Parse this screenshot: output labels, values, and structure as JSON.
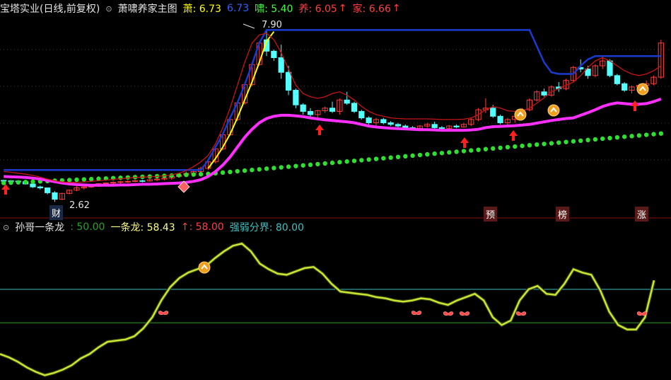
{
  "header": {
    "stock_name": "宝塔实业(日线,前复权)",
    "indicator_name": "萧啸养家主图",
    "items": [
      {
        "label": "萧: 6.73",
        "color": "#ffff00"
      },
      {
        "label": "6.73",
        "color": "#3060ff"
      },
      {
        "label": "啸: 5.40",
        "color": "#40ff40"
      },
      {
        "label": "养: 6.05",
        "color": "#ff30ff"
      },
      {
        "label": "家: 6.66",
        "color": "#ff4040"
      }
    ]
  },
  "indicator_header": {
    "name": "孙哥一条龙",
    "items": [
      {
        "label": ": 50.00",
        "color": "#2aa02a"
      },
      {
        "label": "一条龙: 58.43",
        "color": "#ffff80"
      },
      {
        "label": ": 58.00",
        "color": "#ff4040"
      },
      {
        "label": "强弱分界: 80.00",
        "color": "#40c0c0"
      }
    ]
  },
  "annotations": {
    "high_label": "7.90",
    "low_label": "2.62"
  },
  "badges": [
    "财",
    "预",
    "榜",
    "涨"
  ],
  "icons": {
    "arrow_char": "↑"
  },
  "chart_data": [
    {
      "type": "candlestick",
      "ylim": [
        2.3,
        8.3
      ],
      "candles": [
        [
          3.28,
          3.3,
          3.22,
          3.27
        ],
        [
          3.27,
          3.29,
          3.21,
          3.26
        ],
        [
          3.26,
          3.28,
          3.2,
          3.24
        ],
        [
          3.24,
          3.25,
          3.15,
          3.17
        ],
        [
          3.17,
          3.2,
          3.05,
          3.08
        ],
        [
          3.08,
          3.12,
          3.0,
          3.05
        ],
        [
          3.05,
          3.06,
          2.85,
          2.9
        ],
        [
          2.9,
          2.95,
          2.62,
          2.7
        ],
        [
          2.7,
          2.9,
          2.68,
          2.88
        ],
        [
          2.88,
          3.0,
          2.85,
          2.98
        ],
        [
          2.98,
          3.1,
          2.95,
          3.05
        ],
        [
          3.05,
          3.1,
          3.0,
          3.08
        ],
        [
          3.08,
          3.15,
          3.05,
          3.1
        ],
        [
          3.1,
          3.2,
          3.08,
          3.18
        ],
        [
          3.18,
          3.22,
          3.12,
          3.2
        ],
        [
          3.2,
          3.25,
          3.15,
          3.22
        ],
        [
          3.22,
          3.26,
          3.18,
          3.24
        ],
        [
          3.24,
          3.28,
          3.2,
          3.25
        ],
        [
          3.25,
          3.3,
          3.22,
          3.27
        ],
        [
          3.27,
          3.3,
          3.22,
          3.26
        ],
        [
          3.26,
          3.32,
          3.24,
          3.3
        ],
        [
          3.3,
          3.35,
          3.25,
          3.32
        ],
        [
          3.32,
          3.4,
          3.28,
          3.35
        ],
        [
          3.35,
          3.42,
          3.3,
          3.4
        ],
        [
          3.4,
          3.5,
          3.36,
          3.45
        ],
        [
          3.45,
          3.55,
          3.42,
          3.5
        ],
        [
          3.5,
          3.6,
          3.45,
          3.55
        ],
        [
          3.55,
          3.7,
          3.5,
          3.65
        ],
        [
          3.65,
          3.9,
          3.6,
          3.85
        ],
        [
          3.85,
          4.3,
          3.8,
          4.25
        ],
        [
          4.25,
          4.7,
          4.2,
          4.68
        ],
        [
          4.68,
          5.2,
          4.65,
          5.15
        ],
        [
          5.15,
          5.7,
          5.1,
          5.66
        ],
        [
          5.66,
          6.25,
          5.6,
          6.22
        ],
        [
          6.22,
          6.85,
          6.18,
          6.84
        ],
        [
          6.84,
          7.55,
          6.8,
          7.5
        ],
        [
          7.6,
          7.9,
          7.1,
          7.25
        ],
        [
          7.25,
          7.3,
          6.95,
          7.05
        ],
        [
          7.05,
          7.45,
          6.4,
          6.6
        ],
        [
          6.6,
          6.8,
          5.9,
          6.05
        ],
        [
          6.05,
          6.1,
          5.5,
          5.6
        ],
        [
          5.6,
          5.65,
          5.3,
          5.4
        ],
        [
          5.4,
          5.5,
          5.2,
          5.3
        ],
        [
          5.3,
          5.45,
          5.2,
          5.42
        ],
        [
          5.42,
          5.55,
          5.35,
          5.5
        ],
        [
          5.5,
          5.7,
          5.35,
          5.4
        ],
        [
          5.4,
          5.8,
          5.3,
          5.75
        ],
        [
          5.75,
          6.0,
          5.6,
          5.65
        ],
        [
          5.65,
          5.7,
          5.35,
          5.4
        ],
        [
          5.4,
          5.45,
          5.15,
          5.2
        ],
        [
          5.2,
          5.25,
          5.0,
          5.05
        ],
        [
          5.05,
          5.2,
          4.95,
          5.15
        ],
        [
          5.15,
          5.2,
          5.0,
          5.05
        ],
        [
          5.05,
          5.1,
          4.95,
          5.0
        ],
        [
          5.0,
          5.05,
          4.9,
          4.95
        ],
        [
          4.95,
          5.0,
          4.85,
          4.9
        ],
        [
          4.9,
          4.95,
          4.82,
          4.88
        ],
        [
          4.88,
          4.98,
          4.85,
          4.95
        ],
        [
          4.95,
          5.05,
          4.9,
          5.0
        ],
        [
          5.0,
          5.08,
          4.85,
          4.9
        ],
        [
          4.9,
          4.95,
          4.82,
          4.88
        ],
        [
          4.88,
          4.98,
          4.84,
          4.95
        ],
        [
          4.95,
          5.0,
          4.88,
          4.92
        ],
        [
          4.92,
          5.05,
          4.9,
          5.0
        ],
        [
          5.0,
          5.2,
          4.95,
          5.15
        ],
        [
          5.15,
          5.5,
          5.1,
          5.45
        ],
        [
          5.45,
          5.8,
          5.35,
          5.5
        ],
        [
          5.5,
          5.6,
          5.2,
          5.25
        ],
        [
          5.25,
          5.3,
          5.0,
          5.05
        ],
        [
          5.05,
          5.2,
          4.95,
          5.15
        ],
        [
          5.15,
          5.3,
          5.05,
          5.25
        ],
        [
          5.25,
          5.5,
          5.2,
          5.45
        ],
        [
          5.45,
          5.8,
          5.4,
          5.75
        ],
        [
          5.75,
          6.05,
          5.7,
          6.0
        ],
        [
          6.0,
          6.1,
          5.85,
          5.9
        ],
        [
          5.9,
          6.2,
          5.85,
          6.15
        ],
        [
          6.15,
          6.3,
          6.0,
          6.1
        ],
        [
          6.1,
          6.4,
          6.05,
          6.35
        ],
        [
          6.35,
          6.8,
          6.3,
          6.75
        ],
        [
          6.75,
          7.0,
          6.6,
          6.7
        ],
        [
          6.7,
          6.8,
          6.4,
          6.5
        ],
        [
          6.5,
          6.85,
          6.45,
          6.8
        ],
        [
          6.8,
          7.1,
          6.7,
          6.95
        ],
        [
          6.95,
          7.0,
          6.45,
          6.5
        ],
        [
          6.5,
          6.55,
          6.2,
          6.25
        ],
        [
          6.25,
          6.3,
          6.0,
          6.05
        ],
        [
          6.05,
          6.2,
          5.95,
          6.15
        ],
        [
          6.15,
          6.25,
          6.05,
          6.2
        ],
        [
          6.2,
          6.35,
          6.1,
          6.25
        ],
        [
          6.25,
          6.5,
          6.2,
          6.45
        ],
        [
          6.45,
          7.6,
          6.4,
          7.5
        ]
      ],
      "series": [
        {
          "name": "萧",
          "color": "#ffff00",
          "values": [
            null,
            null,
            null,
            null,
            null,
            null,
            null,
            null,
            null,
            null,
            null,
            null,
            null,
            null,
            null,
            null,
            null,
            null,
            null,
            null,
            null,
            null,
            null,
            null,
            null,
            null,
            null,
            null,
            3.65,
            3.95,
            4.3,
            4.7,
            5.2,
            5.75,
            6.3,
            6.9,
            7.55,
            7.85
          ]
        },
        {
          "name": "6.73",
          "color": "#1a3bd0",
          "values": [
            3.6,
            3.6,
            3.6,
            3.6,
            3.6,
            3.6,
            3.6,
            3.6,
            3.6,
            3.6,
            3.6,
            3.6,
            3.6,
            3.6,
            3.6,
            3.6,
            3.6,
            3.6,
            3.6,
            3.6,
            3.6,
            3.6,
            3.6,
            3.6,
            3.6,
            3.6,
            3.6,
            3.6,
            3.9,
            4.3,
            4.7,
            5.2,
            5.66,
            6.22,
            6.84,
            7.5,
            7.9,
            7.9,
            7.9,
            7.9,
            7.9,
            7.9,
            7.9,
            7.9,
            7.9,
            7.9,
            7.9,
            7.9,
            7.9,
            7.9,
            7.9,
            7.9,
            7.9,
            7.9,
            7.9,
            7.9,
            7.9,
            7.9,
            7.9,
            7.9,
            7.9,
            7.9,
            7.9,
            7.9,
            7.9,
            7.9,
            7.9,
            7.9,
            7.9,
            7.9,
            7.9,
            7.9,
            7.9,
            7.4,
            6.9,
            6.6,
            6.55,
            6.55,
            6.55,
            6.8,
            7.0,
            7.1,
            7.1,
            7.1,
            7.1,
            7.1,
            7.1,
            7.1,
            7.1,
            7.1,
            7.1
          ]
        },
        {
          "name": "啸",
          "color": "#30e030",
          "values": [
            3.2,
            3.21,
            3.22,
            3.23,
            3.24,
            3.25,
            3.26,
            3.27,
            3.28,
            3.29,
            3.3,
            3.31,
            3.32,
            3.33,
            3.34,
            3.35,
            3.36,
            3.37,
            3.38,
            3.39,
            3.4,
            3.41,
            3.42,
            3.43,
            3.44,
            3.45,
            3.46,
            3.47,
            3.48,
            3.5,
            3.52,
            3.54,
            3.56,
            3.58,
            3.6,
            3.62,
            3.64,
            3.66,
            3.68,
            3.7,
            3.72,
            3.74,
            3.76,
            3.78,
            3.8,
            3.82,
            3.84,
            3.86,
            3.88,
            3.9,
            3.92,
            3.94,
            3.96,
            3.98,
            4.0,
            4.02,
            4.04,
            4.06,
            4.08,
            4.1,
            4.12,
            4.14,
            4.16,
            4.18,
            4.2,
            4.22,
            4.24,
            4.26,
            4.28,
            4.3,
            4.32,
            4.34,
            4.36,
            4.38,
            4.4,
            4.42,
            4.44,
            4.46,
            4.48,
            4.5,
            4.52,
            4.54,
            4.56,
            4.58,
            4.6,
            4.62,
            4.64,
            4.66,
            4.68,
            4.7,
            4.72
          ]
        },
        {
          "name": "养",
          "color": "#ff30ff",
          "values": [
            3.4,
            3.39,
            3.38,
            3.37,
            3.35,
            3.32,
            3.28,
            3.24,
            3.2,
            3.17,
            3.15,
            3.14,
            3.13,
            3.13,
            3.13,
            3.13,
            3.14,
            3.14,
            3.15,
            3.16,
            3.16,
            3.17,
            3.18,
            3.19,
            3.2,
            3.22,
            3.25,
            3.3,
            3.4,
            3.55,
            3.75,
            4.0,
            4.3,
            4.6,
            4.85,
            5.05,
            5.18,
            5.25,
            5.28,
            5.28,
            5.26,
            5.24,
            5.2,
            5.17,
            5.14,
            5.12,
            5.1,
            5.08,
            5.05,
            5.0,
            4.95,
            4.92,
            4.9,
            4.88,
            4.87,
            4.86,
            4.85,
            4.84,
            4.84,
            4.83,
            4.82,
            4.82,
            4.82,
            4.82,
            4.83,
            4.85,
            4.9,
            4.93,
            4.94,
            4.95,
            4.96,
            4.98,
            5.0,
            5.04,
            5.08,
            5.12,
            5.15,
            5.18,
            5.2,
            5.28,
            5.36,
            5.45,
            5.55,
            5.62,
            5.66,
            5.64,
            5.62,
            5.62,
            5.64,
            5.7,
            5.78
          ]
        },
        {
          "name": "家",
          "color": "#c81414",
          "values": [
            3.55,
            3.53,
            3.5,
            3.47,
            3.43,
            3.38,
            3.32,
            3.27,
            3.23,
            3.22,
            3.22,
            3.23,
            3.25,
            3.27,
            3.29,
            3.31,
            3.33,
            3.35,
            3.37,
            3.38,
            3.39,
            3.4,
            3.42,
            3.45,
            3.5,
            3.58,
            3.7,
            3.85,
            4.05,
            4.4,
            4.9,
            5.5,
            6.2,
            6.9,
            7.5,
            7.75,
            7.8,
            7.6,
            7.2,
            6.7,
            6.2,
            5.95,
            5.85,
            5.8,
            5.85,
            5.95,
            6.0,
            5.9,
            5.75,
            5.55,
            5.4,
            5.3,
            5.25,
            5.2,
            5.18,
            5.17,
            5.17,
            5.17,
            5.17,
            5.16,
            5.15,
            5.15,
            5.15,
            5.16,
            5.2,
            5.3,
            5.45,
            5.55,
            5.5,
            5.42,
            5.4,
            5.42,
            5.5,
            5.65,
            5.82,
            6.0,
            6.1,
            6.2,
            6.3,
            6.5,
            6.75,
            6.95,
            7.05,
            6.95,
            6.8,
            6.65,
            6.55,
            6.5,
            6.55,
            6.65,
            6.8
          ]
        }
      ]
    },
    {
      "type": "line",
      "ylim": [
        0,
        130
      ],
      "series": [
        {
          "name": "一条龙",
          "color": "#c8e632",
          "values": [
            22,
            19,
            15,
            10,
            6,
            3,
            5,
            8,
            12,
            18,
            22,
            28,
            33,
            34,
            35,
            38,
            45,
            55,
            70,
            82,
            90,
            95,
            98,
            101,
            108,
            114,
            119,
            121,
            114,
            103,
            98,
            94,
            93,
            96,
            99,
            100,
            94,
            85,
            78,
            77,
            76,
            75,
            73,
            72,
            70,
            69,
            70,
            72,
            71,
            68,
            66,
            70,
            73,
            76,
            70,
            55,
            48,
            52,
            70,
            80,
            83,
            76,
            75,
            85,
            98,
            95,
            93,
            79,
            60,
            48,
            44,
            44,
            55,
            88
          ]
        },
        {
          "name": "",
          "color": "#2aa02a",
          "values": [
            50,
            50
          ]
        },
        {
          "name": "强弱分界",
          "color": "#40c0c0",
          "values": [
            80,
            80
          ]
        }
      ]
    }
  ]
}
